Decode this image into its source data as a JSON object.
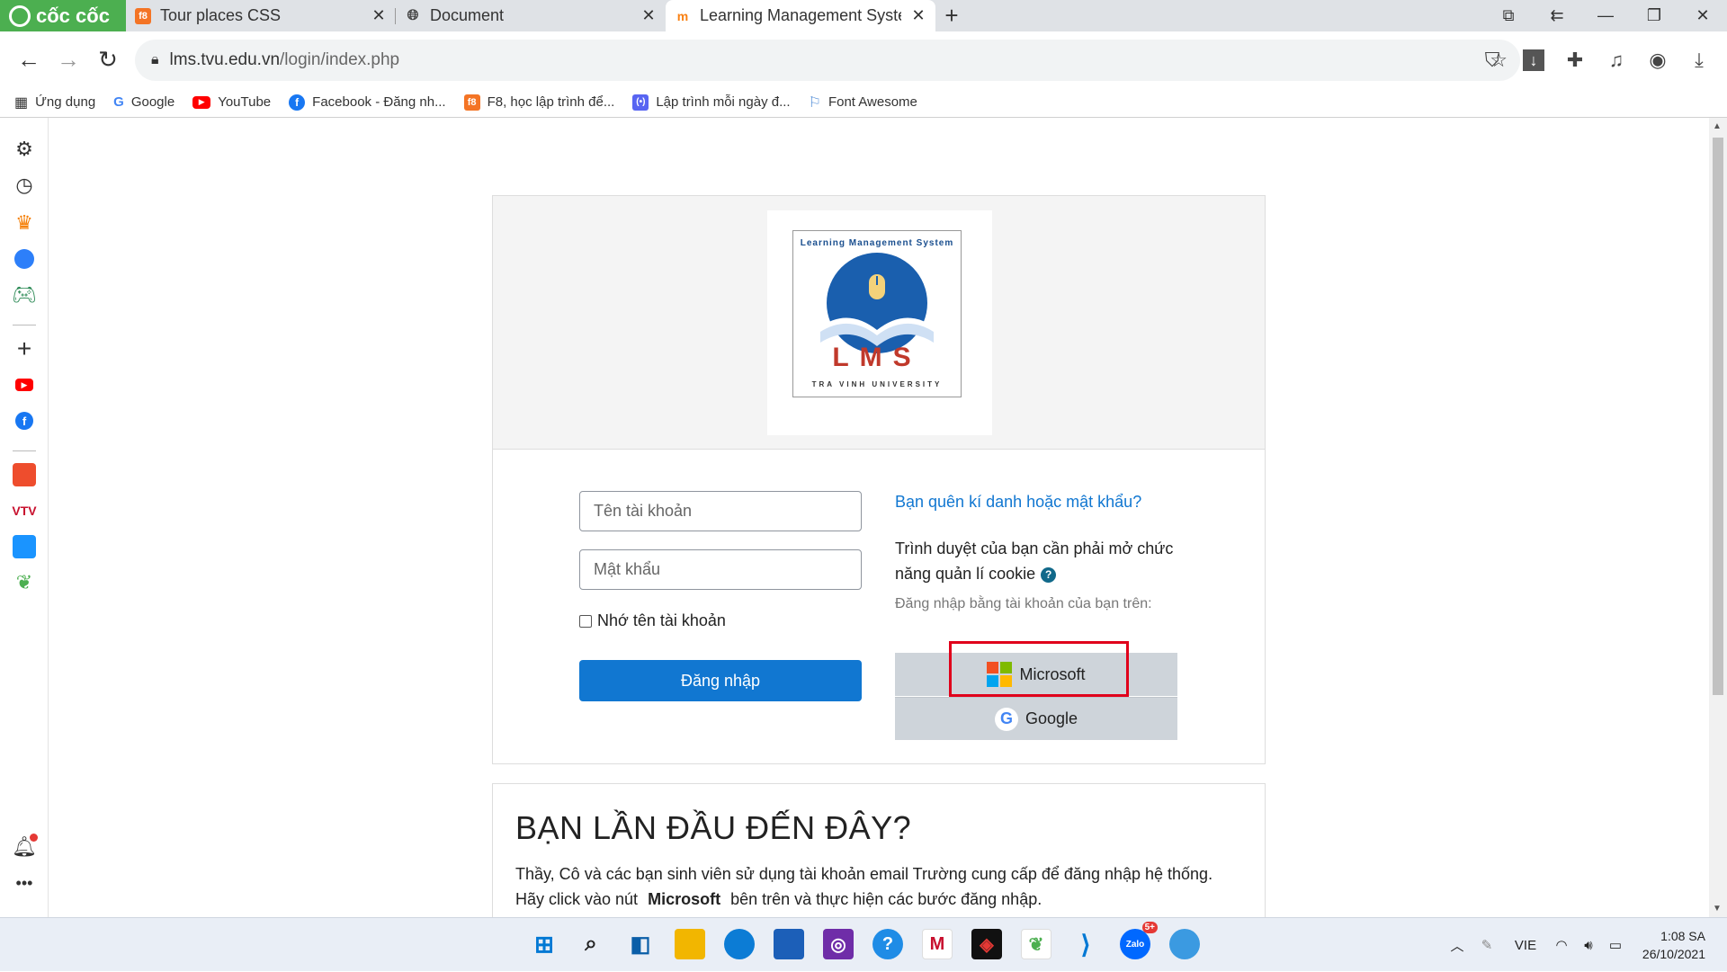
{
  "browser": {
    "brand": "cốc cốc",
    "tabs": [
      {
        "title": "Tour places CSS",
        "favicon": "F8"
      },
      {
        "title": "Document",
        "favicon": "globe"
      },
      {
        "title": "Learning Management Syste",
        "favicon": "moodle"
      }
    ],
    "url_host": "lms.tvu.edu.vn",
    "url_path": "/login/index.php",
    "bookmarks": [
      {
        "label": "Ứng dụng"
      },
      {
        "label": "Google"
      },
      {
        "label": "YouTube"
      },
      {
        "label": "Facebook - Đăng nh..."
      },
      {
        "label": "F8, học lập trình để..."
      },
      {
        "label": "Lập trình mỗi ngày đ..."
      },
      {
        "label": "Font Awesome"
      }
    ]
  },
  "login": {
    "logo": {
      "top_text": "Learning Management System",
      "main": "LMS",
      "bottom": "TRA VINH UNIVERSITY"
    },
    "username_placeholder": "Tên tài khoản",
    "password_placeholder": "Mật khẩu",
    "remember_label": "Nhớ tên tài khoản",
    "login_button": "Đăng nhập",
    "forgot_link": "Bạn quên kí danh hoặc mật khẩu?",
    "cookie_notice": "Trình duyệt của bạn cần phải mở chức năng quản lí cookie",
    "sso_label": "Đăng nhập bằng tài khoản của bạn trên:",
    "microsoft_button": "Microsoft",
    "google_button": "Google"
  },
  "first_time": {
    "heading": "BẠN LẦN ĐẦU ĐẾN ĐÂY?",
    "line1": "Thầy, Cô và các bạn sinh viên sử dụng tài khoản email Trường cung cấp để đăng nhập hệ thống.",
    "line2_pre": "Hãy click vào nút",
    "line2_bold": "Microsoft",
    "line2_post": "bên trên và thực hiện các bước đăng nhập."
  },
  "taskbar": {
    "language": "VIE",
    "time": "1:08 SA",
    "date": "26/10/2021",
    "zalo_badge": "5+"
  },
  "colors": {
    "brand_green": "#4caf50",
    "primary_blue": "#1177d1",
    "highlight_red": "#e0001b"
  }
}
